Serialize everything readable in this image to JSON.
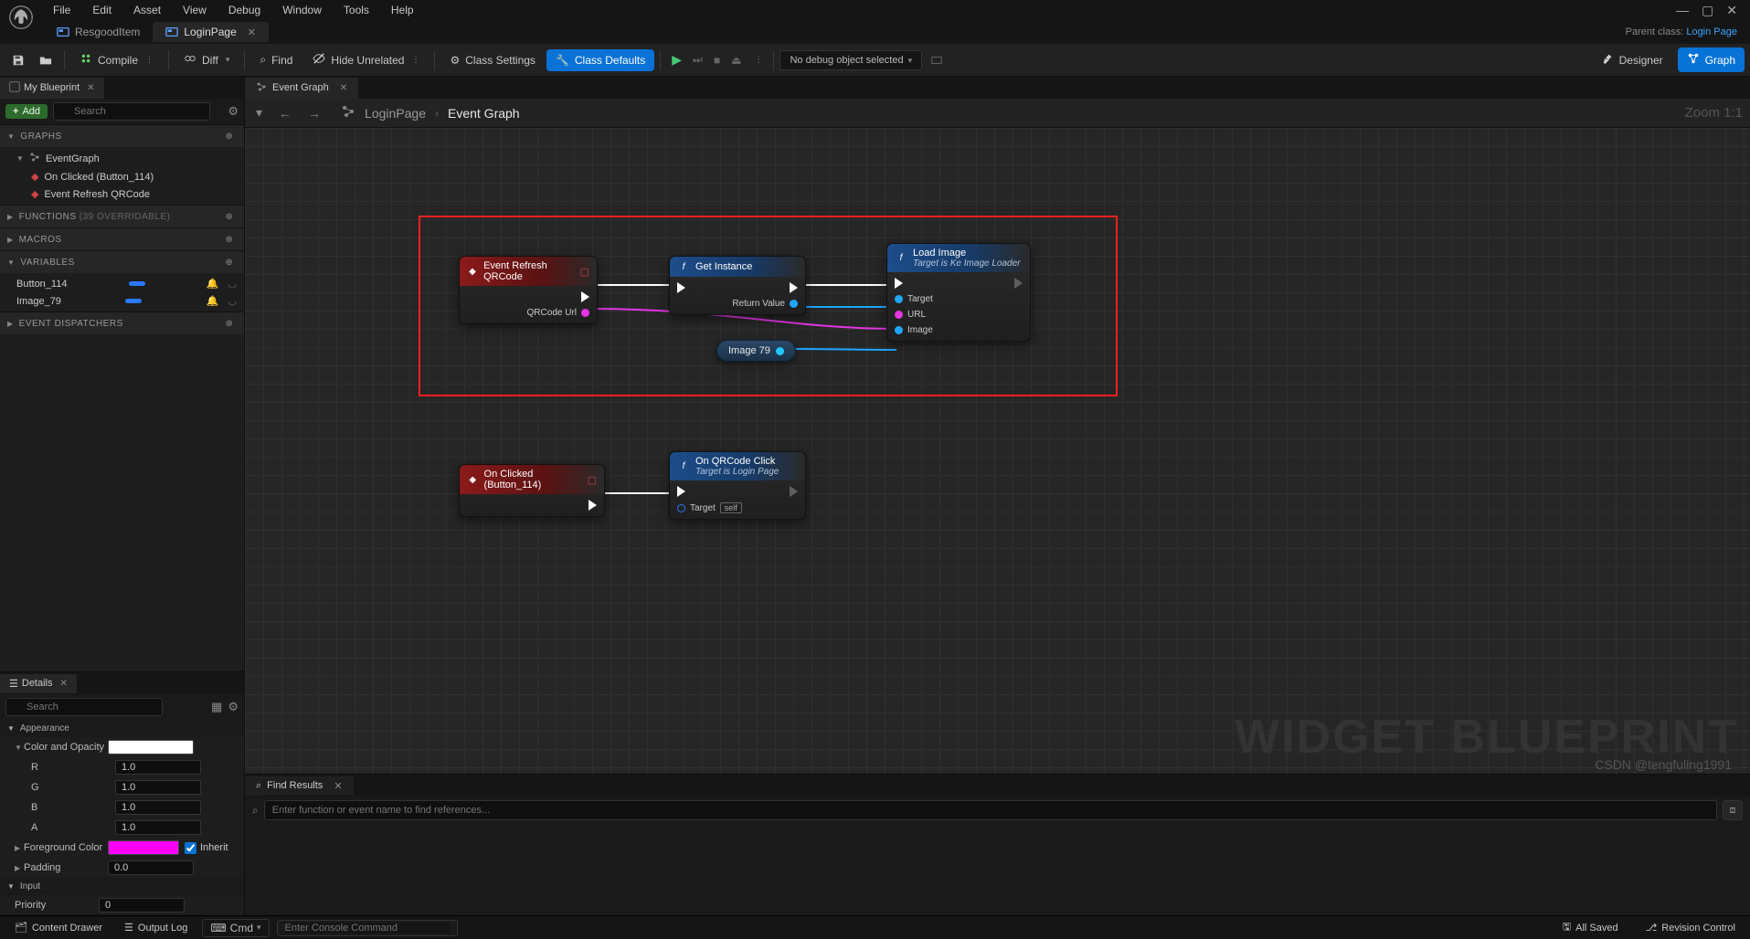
{
  "menubar": {
    "items": [
      "File",
      "Edit",
      "Asset",
      "View",
      "Debug",
      "Window",
      "Tools",
      "Help"
    ]
  },
  "asset_tabs": {
    "tabs": [
      {
        "label": "ResgoodItem",
        "active": false
      },
      {
        "label": "LoginPage",
        "active": true
      }
    ]
  },
  "parent_class": {
    "prefix": "Parent class:",
    "link": "Login Page"
  },
  "toolbar": {
    "compile": "Compile",
    "diff": "Diff",
    "find": "Find",
    "hide_unrelated": "Hide Unrelated",
    "class_settings": "Class Settings",
    "class_defaults": "Class Defaults",
    "debug_select": "No debug object selected",
    "designer": "Designer",
    "graph": "Graph"
  },
  "left": {
    "my_blueprint_tab": "My Blueprint",
    "add_btn": "Add",
    "search_placeholder": "Search",
    "sections": {
      "graphs": {
        "title": "GRAPHS"
      },
      "functions": {
        "title": "FUNCTIONS",
        "count": "(39 OVERRIDABLE)"
      },
      "macros": {
        "title": "MACROS"
      },
      "variables": {
        "title": "VARIABLES"
      },
      "dispatchers": {
        "title": "EVENT DISPATCHERS"
      }
    },
    "tree": {
      "event_graph": "EventGraph",
      "on_clicked": "On Clicked (Button_114)",
      "refresh": "Event Refresh QRCode",
      "var_button": "Button_114",
      "var_image": "Image_79"
    }
  },
  "details": {
    "tab": "Details",
    "search_placeholder": "Search",
    "appearance": "Appearance",
    "color_opacity": "Color and Opacity",
    "channels": {
      "r": "R",
      "g": "G",
      "b": "B",
      "a": "A",
      "val": "1.0"
    },
    "foreground": "Foreground Color",
    "inherit": "Inherit",
    "padding": {
      "label": "Padding",
      "val": "0.0"
    },
    "input": "Input",
    "priority": {
      "label": "Priority",
      "val": "0"
    },
    "colors": {
      "white": "#ffffff",
      "magenta": "#ff00ff"
    }
  },
  "graph": {
    "tab": "Event Graph",
    "crumb_root": "LoginPage",
    "crumb_leaf": "Event Graph",
    "zoom": "Zoom 1:1",
    "watermark": "WIDGET BLUEPRINT",
    "csdn": "CSDN @tengfuling1991",
    "nodes": {
      "refresh": {
        "title": "Event Refresh QRCode",
        "pin_out": "QRCode Url"
      },
      "getinst": {
        "title": "Get Instance",
        "pin_out": "Return Value"
      },
      "loadimg": {
        "title": "Load Image",
        "sub": "Target is Ke Image Loader",
        "p_target": "Target",
        "p_url": "URL",
        "p_image": "Image"
      },
      "image79": {
        "title": "Image 79"
      },
      "onclick": {
        "title": "On Clicked (Button_114)"
      },
      "qrclick": {
        "title": "On QRCode Click",
        "sub": "Target is Login Page",
        "p_target": "Target",
        "p_self": "self"
      }
    }
  },
  "find": {
    "tab": "Find Results",
    "placeholder": "Enter function or event name to find references..."
  },
  "bottom": {
    "content_drawer": "Content Drawer",
    "output_log": "Output Log",
    "cmd_label": "Cmd",
    "cmd_placeholder": "Enter Console Command",
    "unsaved": "All Saved",
    "revision": "Revision Control"
  }
}
